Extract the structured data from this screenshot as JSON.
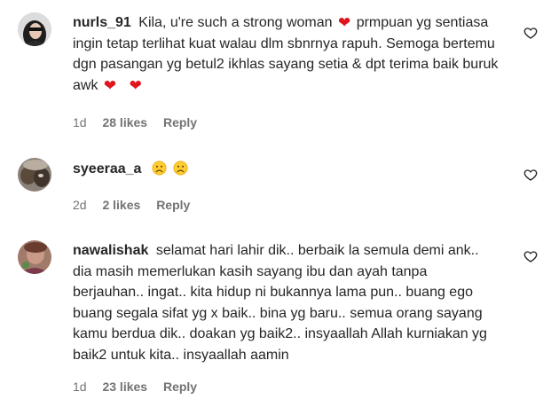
{
  "comments": [
    {
      "username": "nurls_91",
      "text_1": "Kila, u're such a strong woman",
      "text_2": "prmpuan yg sentiasa ingin tetap terlihat kuat walau dlm sbnrnya rapuh. Semoga bertemu dgn pasangan yg betul2 ikhlas sayang setia & dpt terima baik buruk awk",
      "emoji": "❤",
      "time": "1d",
      "likes": "28 likes",
      "reply": "Reply"
    },
    {
      "username": "syeeraa_a",
      "time": "2d",
      "likes": "2 likes",
      "reply": "Reply"
    },
    {
      "username": "nawalishak",
      "text": "selamat hari lahir dik.. berbaik la semula demi ank.. dia masih memerlukan kasih sayang ibu dan ayah tanpa berjauhan.. ingat.. kita hidup ni bukannya lama pun.. buang ego buang segala sifat yg x baik.. bina yg baru.. semua orang sayang kamu berdua dik.. doakan yg baik2.. insyaallah Allah kurniakan yg baik2 untuk kita.. insyaallah aamin",
      "time": "1d",
      "likes": "23 likes",
      "reply": "Reply"
    }
  ]
}
